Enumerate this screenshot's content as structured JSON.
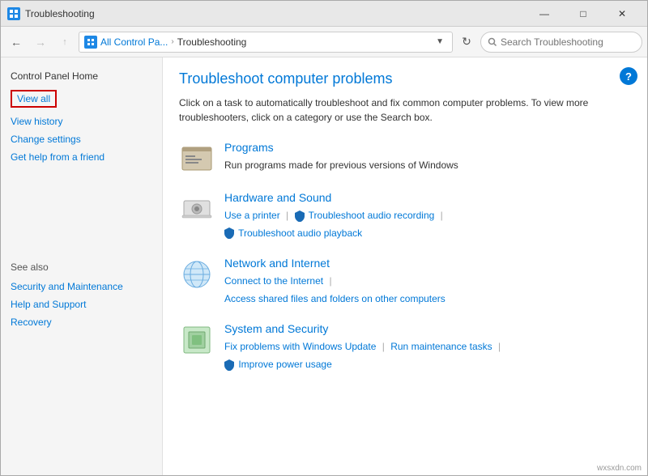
{
  "titlebar": {
    "icon": "control-panel-icon",
    "title": "Troubleshooting",
    "minimize": "—",
    "maximize": "□",
    "close": "✕"
  },
  "addressbar": {
    "back": "←",
    "forward": "→",
    "up": "↑",
    "breadcrumb_prefix": "All Control Pa...",
    "breadcrumb_separator": "›",
    "breadcrumb_current": "Troubleshooting",
    "search_placeholder": "Search Troubleshooting",
    "refresh": "↻"
  },
  "sidebar": {
    "home_label": "Control Panel Home",
    "links": [
      {
        "id": "view-all",
        "label": "View all",
        "highlighted": true
      },
      {
        "id": "view-history",
        "label": "View history",
        "highlighted": false
      },
      {
        "id": "change-settings",
        "label": "Change settings",
        "highlighted": false
      },
      {
        "id": "get-help",
        "label": "Get help from a friend",
        "highlighted": false
      }
    ],
    "see_also_label": "See also",
    "see_also_links": [
      {
        "id": "security",
        "label": "Security and Maintenance"
      },
      {
        "id": "help-support",
        "label": "Help and Support"
      },
      {
        "id": "recovery",
        "label": "Recovery"
      }
    ]
  },
  "main": {
    "title": "Troubleshoot computer problems",
    "description": "Click on a task to automatically troubleshoot and fix common computer problems. To view more troubleshooters, click on a category or use the Search box.",
    "help_label": "?",
    "categories": [
      {
        "id": "programs",
        "title": "Programs",
        "subtitle": "Run programs made for previous versions of Windows",
        "links": []
      },
      {
        "id": "hardware-sound",
        "title": "Hardware and Sound",
        "subtitle": "",
        "links": [
          {
            "id": "use-printer",
            "label": "Use a printer"
          },
          {
            "id": "troubleshoot-audio-recording",
            "label": "Troubleshoot audio recording",
            "shield": true
          },
          {
            "id": "troubleshoot-audio-playback",
            "label": "Troubleshoot audio playback",
            "shield": true
          }
        ]
      },
      {
        "id": "network-internet",
        "title": "Network and Internet",
        "subtitle": "",
        "links": [
          {
            "id": "connect-internet",
            "label": "Connect to the Internet"
          },
          {
            "id": "access-shared",
            "label": "Access shared files and folders on other computers"
          }
        ]
      },
      {
        "id": "system-security",
        "title": "System and Security",
        "subtitle": "",
        "links": [
          {
            "id": "fix-windows-update",
            "label": "Fix problems with Windows Update"
          },
          {
            "id": "run-maintenance",
            "label": "Run maintenance tasks"
          },
          {
            "id": "improve-power",
            "label": "Improve power usage",
            "shield": true
          }
        ]
      }
    ]
  },
  "watermark": "wxsxdn.com"
}
